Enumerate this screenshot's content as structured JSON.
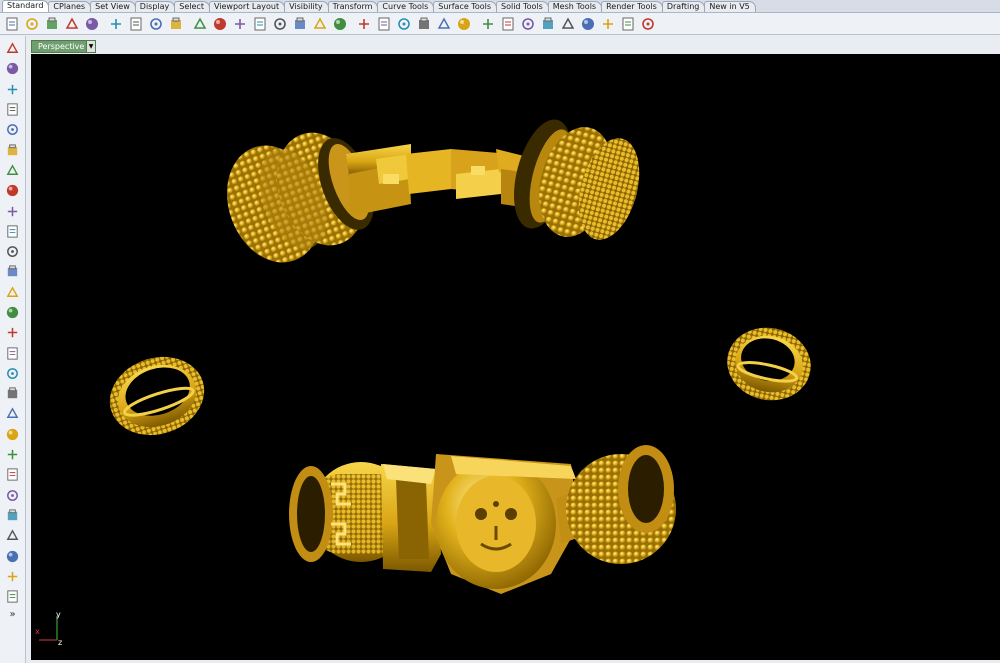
{
  "tabs": [
    {
      "label": "Standard",
      "active": true
    },
    {
      "label": "CPlanes"
    },
    {
      "label": "Set View"
    },
    {
      "label": "Display"
    },
    {
      "label": "Select"
    },
    {
      "label": "Viewport Layout"
    },
    {
      "label": "Visibility"
    },
    {
      "label": "Transform"
    },
    {
      "label": "Curve Tools"
    },
    {
      "label": "Surface Tools"
    },
    {
      "label": "Solid Tools"
    },
    {
      "label": "Mesh Tools"
    },
    {
      "label": "Render Tools"
    },
    {
      "label": "Drafting"
    },
    {
      "label": "New in V5"
    }
  ],
  "toolbar_icons": [
    "new-icon",
    "open-icon",
    "save-icon",
    "print-icon",
    "import-icon",
    "cut-icon",
    "copy-icon",
    "paste-icon",
    "undo-icon",
    "pan-icon",
    "move-view-icon",
    "zoom-icon",
    "zoom-window-icon",
    "zoom-extents-icon",
    "zoom-selected-icon",
    "rotate-view-icon",
    "four-viewports-icon",
    "layer-icon",
    "properties-icon",
    "hide-icon",
    "show-icon",
    "lock-icon",
    "unlock-icon",
    "light-icon",
    "shade-icon",
    "color-wheel-icon",
    "rendered-icon",
    "render-icon",
    "material-icon",
    "options-icon",
    "grasshopper-icon",
    "help-icon"
  ],
  "left_icons": [
    "select-icon",
    "point-icon",
    "polyline-icon",
    "curve-icon",
    "circle-icon",
    "ellipse-icon",
    "arc-icon",
    "rectangle-icon",
    "polygon-icon",
    "freeform-curve-icon",
    "surface-icon",
    "extrude-icon",
    "solid-box-icon",
    "boolean-union-icon",
    "cylinder-icon",
    "mesh-icon",
    "array-icon",
    "transform-icon",
    "dimension-icon",
    "edit-points-icon",
    "analyze-icon",
    "fillet-icon",
    "offset-icon",
    "text-icon",
    "group-icon",
    "block-icon",
    "cplane-icon",
    "solid-tools-icon"
  ],
  "viewport": {
    "name": "Perspective",
    "background": "#000000",
    "object_color": "#d4a017",
    "axes": {
      "x": "x",
      "y": "y",
      "z": "z"
    }
  },
  "more_label": "»"
}
